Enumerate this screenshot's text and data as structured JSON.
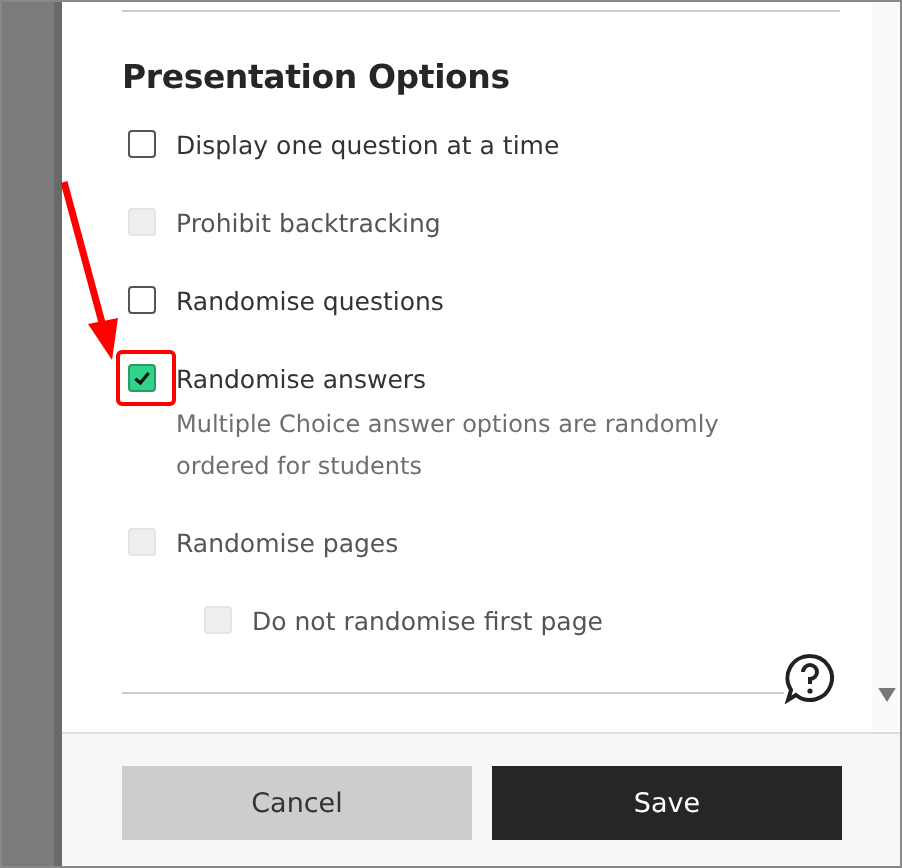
{
  "section": {
    "title": "Presentation Options"
  },
  "options": [
    {
      "label": "Display one question at a time",
      "checked": false,
      "disabled": false
    },
    {
      "label": "Prohibit backtracking",
      "checked": false,
      "disabled": true
    },
    {
      "label": "Randomise questions",
      "checked": false,
      "disabled": false
    },
    {
      "label": "Randomise answers",
      "checked": true,
      "disabled": false,
      "description": "Multiple Choice answer options are randomly ordered for students"
    },
    {
      "label": "Randomise pages",
      "checked": false,
      "disabled": true,
      "children": [
        {
          "label": "Do not randomise first page",
          "checked": false,
          "disabled": true
        }
      ]
    }
  ],
  "buttons": [
    {
      "label": "Cancel",
      "kind": "secondary"
    },
    {
      "label": "Save",
      "kind": "primary"
    }
  ]
}
